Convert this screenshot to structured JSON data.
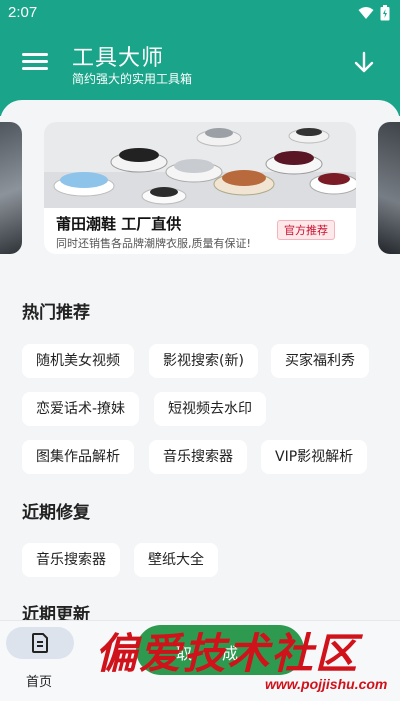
{
  "status_bar": {
    "time": "2:07"
  },
  "header": {
    "title": "工具大师",
    "subtitle": "简约强大的实用工具箱"
  },
  "banner": {
    "title": "莆田潮鞋  工厂直供",
    "description": "同时还销售各品牌潮牌衣服,质量有保证!",
    "badge": "官方推荐"
  },
  "sections": {
    "hot": {
      "title": "热门推荐",
      "items": [
        "随机美女视频",
        "影视搜索(新)",
        "买家福利秀",
        "恋爱话术-撩妹",
        "短视频去水印",
        "图集作品解析",
        "音乐搜索器",
        "VIP影视解析"
      ]
    },
    "recent_fix": {
      "title": "近期修复",
      "items": [
        "音乐搜索器",
        "壁纸大全"
      ]
    },
    "recent_update": {
      "title": "近期更新"
    }
  },
  "bottom_nav": {
    "home_label": "首页"
  },
  "fab": {
    "label": "取成"
  },
  "watermark": {
    "text": "偏爱技术社区",
    "url": "www.pojjishu.com"
  },
  "colors": {
    "primary": "#1aa58a",
    "background": "#f3f5f7",
    "badge_red": "#c8102e",
    "fab_green": "#2e9a4f"
  }
}
